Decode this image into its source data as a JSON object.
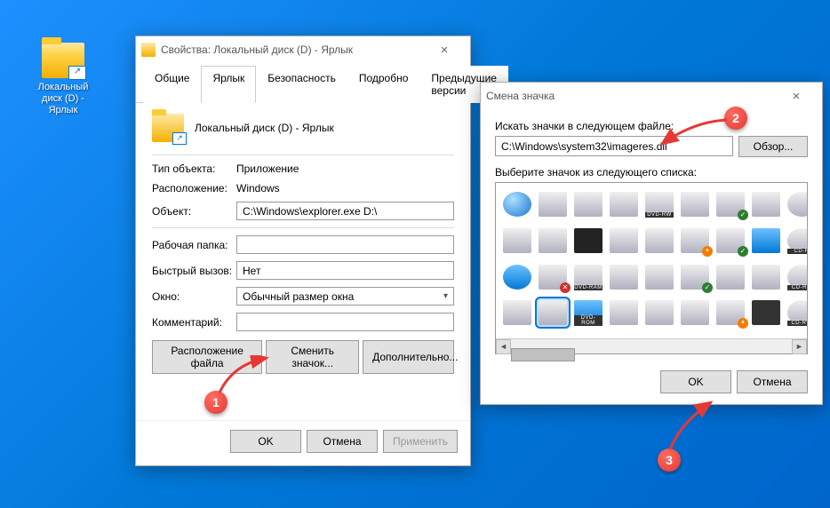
{
  "desktop": {
    "icon_label": "Локальный диск (D) - Ярлык"
  },
  "props": {
    "title": "Свойства: Локальный диск (D) - Ярлык",
    "tabs": [
      "Общие",
      "Ярлык",
      "Безопасность",
      "Подробно",
      "Предыдущие версии"
    ],
    "active_tab": 1,
    "header_name": "Локальный диск (D) - Ярлык",
    "labels": {
      "type": "Тип объекта:",
      "location": "Расположение:",
      "target": "Объект:",
      "startin": "Рабочая папка:",
      "shortcut": "Быстрый вызов:",
      "run": "Окно:",
      "comment": "Комментарий:"
    },
    "values": {
      "type": "Приложение",
      "location": "Windows",
      "target": "C:\\Windows\\explorer.exe D:\\",
      "startin": "",
      "shortcut": "Нет",
      "run": "Обычный размер окна",
      "comment": ""
    },
    "buttons": {
      "open_location": "Расположение файла",
      "change_icon": "Сменить значок...",
      "advanced": "Дополнительно..."
    },
    "footer": {
      "ok": "OK",
      "cancel": "Отмена",
      "apply": "Применить"
    }
  },
  "changeicon": {
    "title": "Смена значка",
    "look_label": "Искать значки в следующем файле:",
    "path": "C:\\Windows\\system32\\imageres.dll",
    "browse": "Обзор...",
    "list_label": "Выберите значок из следующего списка:",
    "footer": {
      "ok": "OK",
      "cancel": "Отмена"
    }
  },
  "callouts": {
    "1": "1",
    "2": "2",
    "3": "3"
  }
}
